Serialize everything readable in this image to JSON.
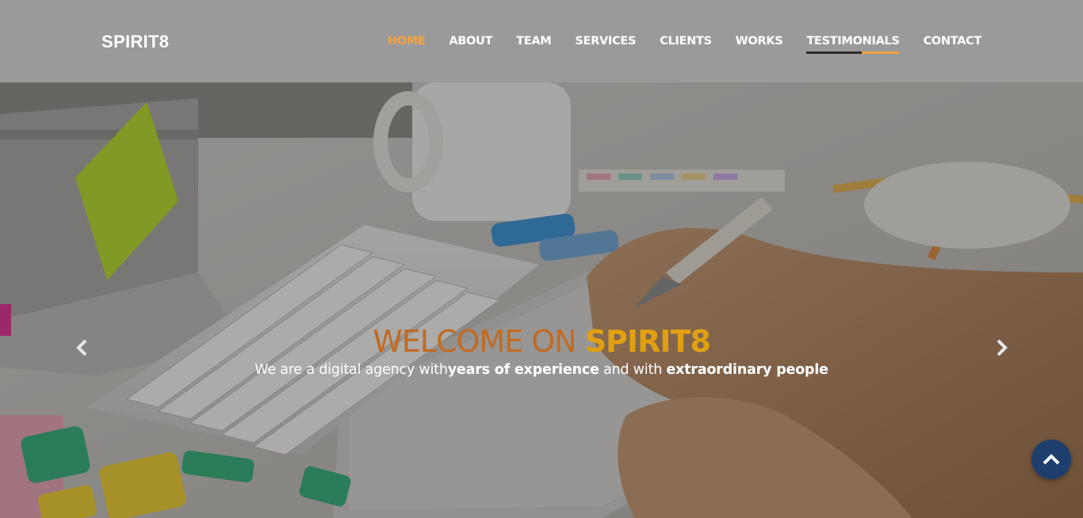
{
  "brand": {
    "name": "SPIRIT8"
  },
  "nav": {
    "items": [
      {
        "label": "HOME"
      },
      {
        "label": "ABOUT"
      },
      {
        "label": "TEAM"
      },
      {
        "label": "SERVICES"
      },
      {
        "label": "CLIENTS"
      },
      {
        "label": "WORKS"
      },
      {
        "label": "TESTIMONIALS"
      },
      {
        "label": "CONTACT"
      }
    ]
  },
  "hero": {
    "title_light": "WELCOME ON ",
    "title_bold": "SPIRIT8",
    "subtitle": {
      "part1": "We are a digital agency with",
      "bold1": "years of experience",
      "part2": " and with ",
      "bold2": "extraordinary people"
    }
  },
  "icons": {
    "prev": "chevron-left-icon",
    "next": "chevron-right-icon",
    "back_to_top": "chevron-up-icon"
  },
  "colors": {
    "navbar_bg": "#9a9a9a",
    "accent_orange": "#f7a23a",
    "title_light": "#c26a22",
    "title_bold": "#e0a012",
    "back_to_top_bg": "#1e3f6e"
  }
}
